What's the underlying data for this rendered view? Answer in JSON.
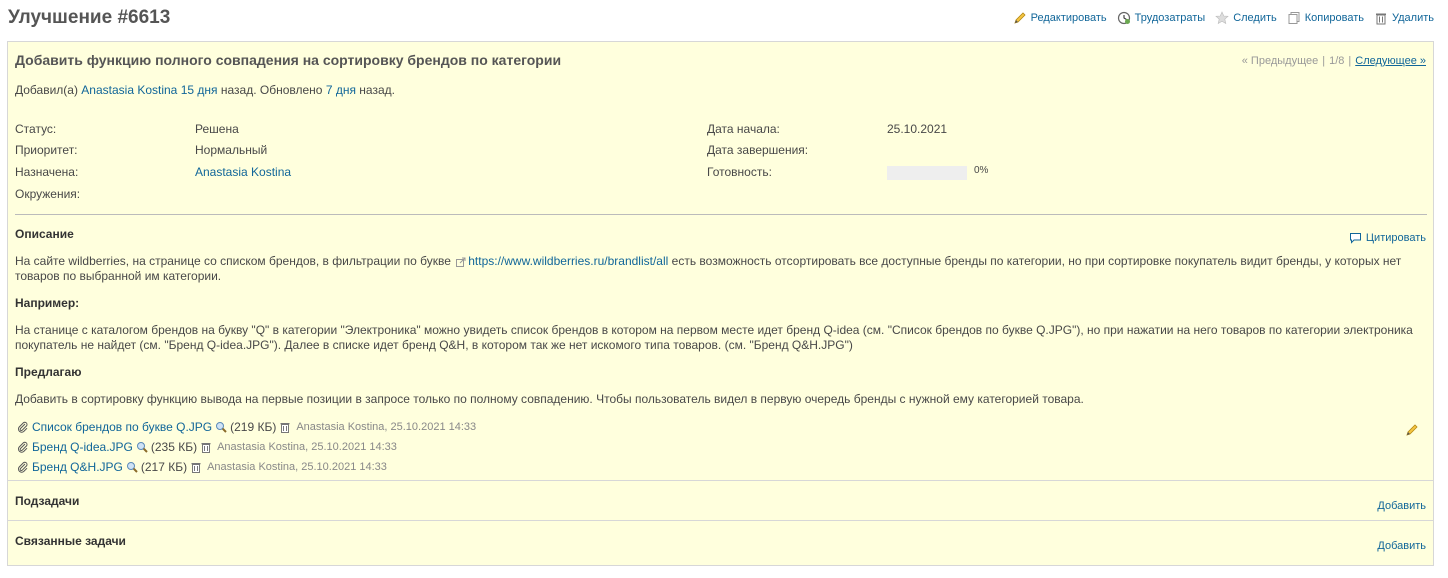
{
  "page": {
    "title": "Улучшение #6613"
  },
  "toolbar": {
    "edit": "Редактировать",
    "time": "Трудозатраты",
    "watch": "Следить",
    "copy": "Копировать",
    "delete": "Удалить"
  },
  "issue": {
    "subject": "Добавить функцию полного совпадения на сортировку брендов по категории",
    "nav": {
      "prev": "« Предыдущее",
      "sep1": "|",
      "position": "1/8",
      "sep2": "|",
      "next": "Следующее »"
    },
    "author": {
      "prefix": "Добавил(а)",
      "name": "Anastasia Kostina",
      "created": "15 дня",
      "mid": "назад. Обновлено",
      "updated": "7 дня",
      "suffix": "назад."
    },
    "attributes": {
      "status_label": "Статус:",
      "status_value": "Решена",
      "priority_label": "Приоритет:",
      "priority_value": "Нормальный",
      "assignee_label": "Назначена:",
      "assignee_value": "Anastasia Kostina",
      "environment_label": "Окружения:",
      "start_label": "Дата начала:",
      "start_value": "25.10.2021",
      "due_label": "Дата завершения:",
      "done_label": "Готовность:",
      "done_text": "0%",
      "done_ratio": 0
    },
    "description": {
      "heading": "Описание",
      "quote": "Цитировать",
      "p1_before": "На сайте wildberries, на странице со списком брендов, в фильтрации по букве",
      "p1_link": "https://www.wildberries.ru/brandlist/all",
      "p1_after": "есть возможность отсортировать все доступные бренды по категории, но при сортировке покупатель видит бренды, у которых нет товаров по выбранной им категории.",
      "h2": "Например:",
      "p2": "На станице с каталогом брендов на букву \"Q\" в категории \"Электроника\" можно увидеть список брендов в котором на первом месте идет бренд Q-idea (см. \"Список брендов по букве Q.JPG\"), но при нажатии на него товаров по категории электроника покупатель не найдет (см. \"Бренд Q-idea.JPG\"). Далее в списке идет бренд Q&H, в котором так же нет искомого типа товаров. (см. \"Бренд Q&H.JPG\")",
      "h3": "Предлагаю",
      "p3": "Добавить в сортировку функцию вывода на первые позиции в запросе только по полному совпадению. Чтобы пользователь видел в первую очередь бренды с нужной ему категорией товара."
    },
    "attachments": [
      {
        "name": "Список брендов по букве Q.JPG",
        "size": "(219 КБ)",
        "meta": "Anastasia Kostina, 25.10.2021 14:33"
      },
      {
        "name": "Бренд Q-idea.JPG",
        "size": "(235 КБ)",
        "meta": "Anastasia Kostina, 25.10.2021 14:33"
      },
      {
        "name": "Бренд Q&H.JPG",
        "size": "(217 КБ)",
        "meta": "Anastasia Kostina, 25.10.2021 14:33"
      }
    ],
    "subtasks": {
      "title": "Подзадачи",
      "add": "Добавить"
    },
    "relations": {
      "title": "Связанные задачи",
      "add": "Добавить"
    }
  },
  "colors": {
    "link": "#116699",
    "issue_bg": "#ffffdd",
    "progress_bg": "#eeeeee"
  }
}
